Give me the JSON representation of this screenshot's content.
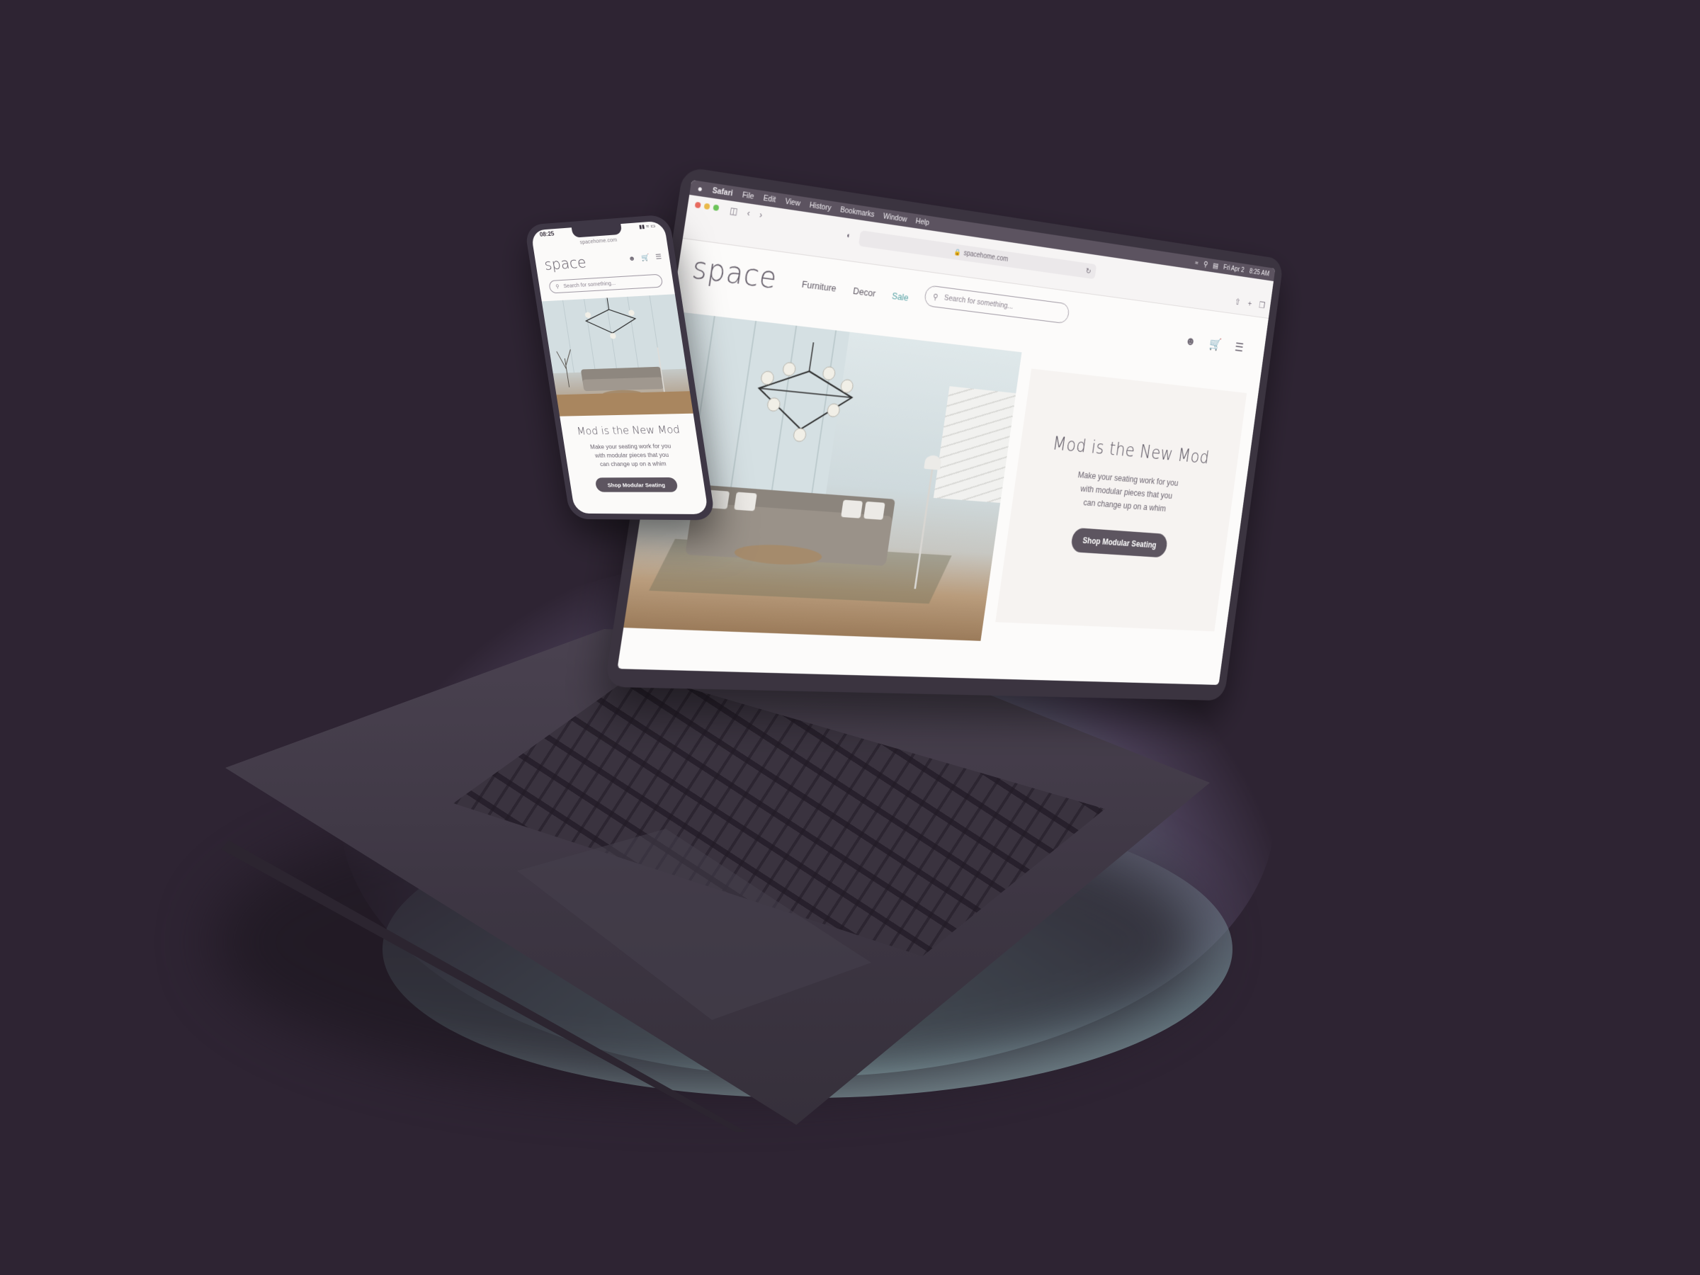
{
  "laptop": {
    "menubar": {
      "apple_icon": "apple-icon",
      "app": "Safari",
      "menus": [
        "File",
        "Edit",
        "View",
        "History",
        "Bookmarks",
        "Window",
        "Help"
      ],
      "date": "Fri Apr 2",
      "time": "8:25 AM"
    },
    "browser": {
      "url": "spacehome.com"
    },
    "site": {
      "logo": "space",
      "nav": [
        "Furniture",
        "Decor",
        "Sale"
      ],
      "search_placeholder": "Search for something...",
      "hero": {
        "title": "Mod is the New Mod",
        "subtitle_lines": [
          "Make your seating work for you",
          "with modular pieces that you",
          "can change up on a whim"
        ],
        "cta": "Shop Modular Seating"
      }
    },
    "colors": {
      "accent_sale": "#58a3a6",
      "button": "#5d5560",
      "hero_panel": "#f6f3f1"
    }
  },
  "phone": {
    "time": "08:25",
    "url": "spacehome.com",
    "logo": "space",
    "search_placeholder": "Search for something...",
    "hero": {
      "title": "Mod is the New Mod",
      "subtitle_lines": [
        "Make your seating work for you",
        "with modular pieces that you",
        "can change up on a whim"
      ],
      "cta": "Shop Modular Seating"
    }
  }
}
